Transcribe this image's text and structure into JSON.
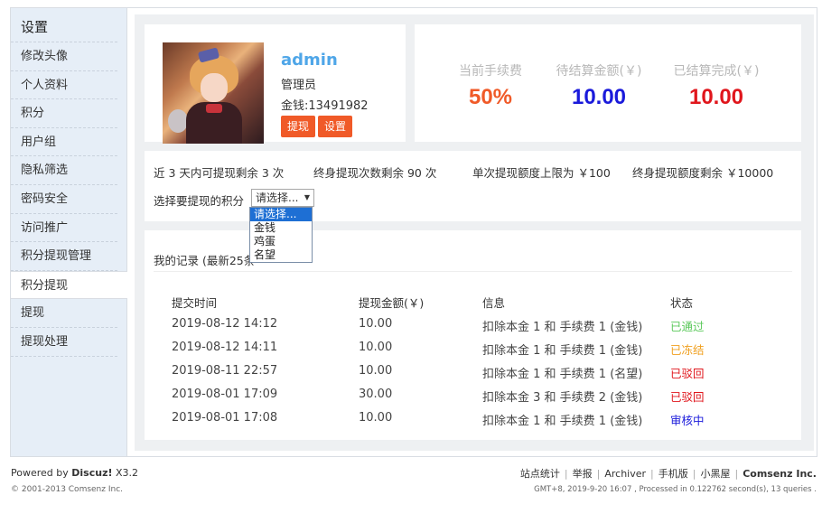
{
  "sidebar": {
    "title": "设置",
    "items": [
      {
        "label": "修改头像"
      },
      {
        "label": "个人资料"
      },
      {
        "label": "积分"
      },
      {
        "label": "用户组"
      },
      {
        "label": "隐私筛选"
      },
      {
        "label": "密码安全"
      },
      {
        "label": "访问推广"
      },
      {
        "label": "积分提现管理"
      },
      {
        "label": "积分提现"
      },
      {
        "label": "提现"
      },
      {
        "label": "提现处理"
      }
    ]
  },
  "profile": {
    "username": "admin",
    "role": "管理员",
    "money": "金钱:13491982",
    "withdraw_btn": "提现",
    "settings_btn": "设置"
  },
  "stats": [
    {
      "label": "当前手续费",
      "value": "50%",
      "color": "#f05a28"
    },
    {
      "label": "待结算金额(￥)",
      "value": "10.00",
      "color": "#1a1adb"
    },
    {
      "label": "已结算完成(￥)",
      "value": "10.00",
      "color": "#e0161c"
    }
  ],
  "info": {
    "limits": [
      "近 3 天内可提现剩余 3 次",
      "终身提现次数剩余 90 次",
      "单次提现额度上限为 ￥100",
      "终身提现额度剩余 ￥10000"
    ],
    "select_label": "选择要提现的积分",
    "select_value": "请选择...",
    "options": [
      "请选择...",
      "金钱",
      "鸡蛋",
      "名望"
    ]
  },
  "records": {
    "title": "我的记录 (最新25条",
    "headers": [
      "提交时间",
      "提现金额(￥)",
      "信息",
      "状态"
    ],
    "rows": [
      {
        "time": "2019-08-12 14:12",
        "amount": "10.00",
        "info": "扣除本金 1 和 手续费 1 (金钱)",
        "status": "已通过",
        "status_color": "#5cc95c"
      },
      {
        "time": "2019-08-12 14:11",
        "amount": "10.00",
        "info": "扣除本金 1 和 手续费 1 (金钱)",
        "status": "已冻结",
        "status_color": "#f0a020"
      },
      {
        "time": "2019-08-11 22:57",
        "amount": "10.00",
        "info": "扣除本金 1 和 手续费 1 (名望)",
        "status": "已驳回",
        "status_color": "#e0161c"
      },
      {
        "time": "2019-08-01 17:09",
        "amount": "30.00",
        "info": "扣除本金 3 和 手续费 2 (金钱)",
        "status": "已驳回",
        "status_color": "#e0161c"
      },
      {
        "time": "2019-08-01 17:08",
        "amount": "10.00",
        "info": "扣除本金 1 和 手续费 1 (金钱)",
        "status": "审核中",
        "status_color": "#1a1adb"
      }
    ]
  },
  "footer": {
    "powered_prefix": "Powered by ",
    "powered_brand": "Discuz!",
    "powered_version": " X3.2",
    "copyright": "© 2001-2013 Comsenz Inc.",
    "links": [
      "站点统计",
      "举报",
      "Archiver",
      "手机版",
      "小黑屋"
    ],
    "company": "Comsenz Inc.",
    "stats_line": "GMT+8, 2019-9-20 16:07 , Processed in 0.122762 second(s), 13 queries ."
  }
}
